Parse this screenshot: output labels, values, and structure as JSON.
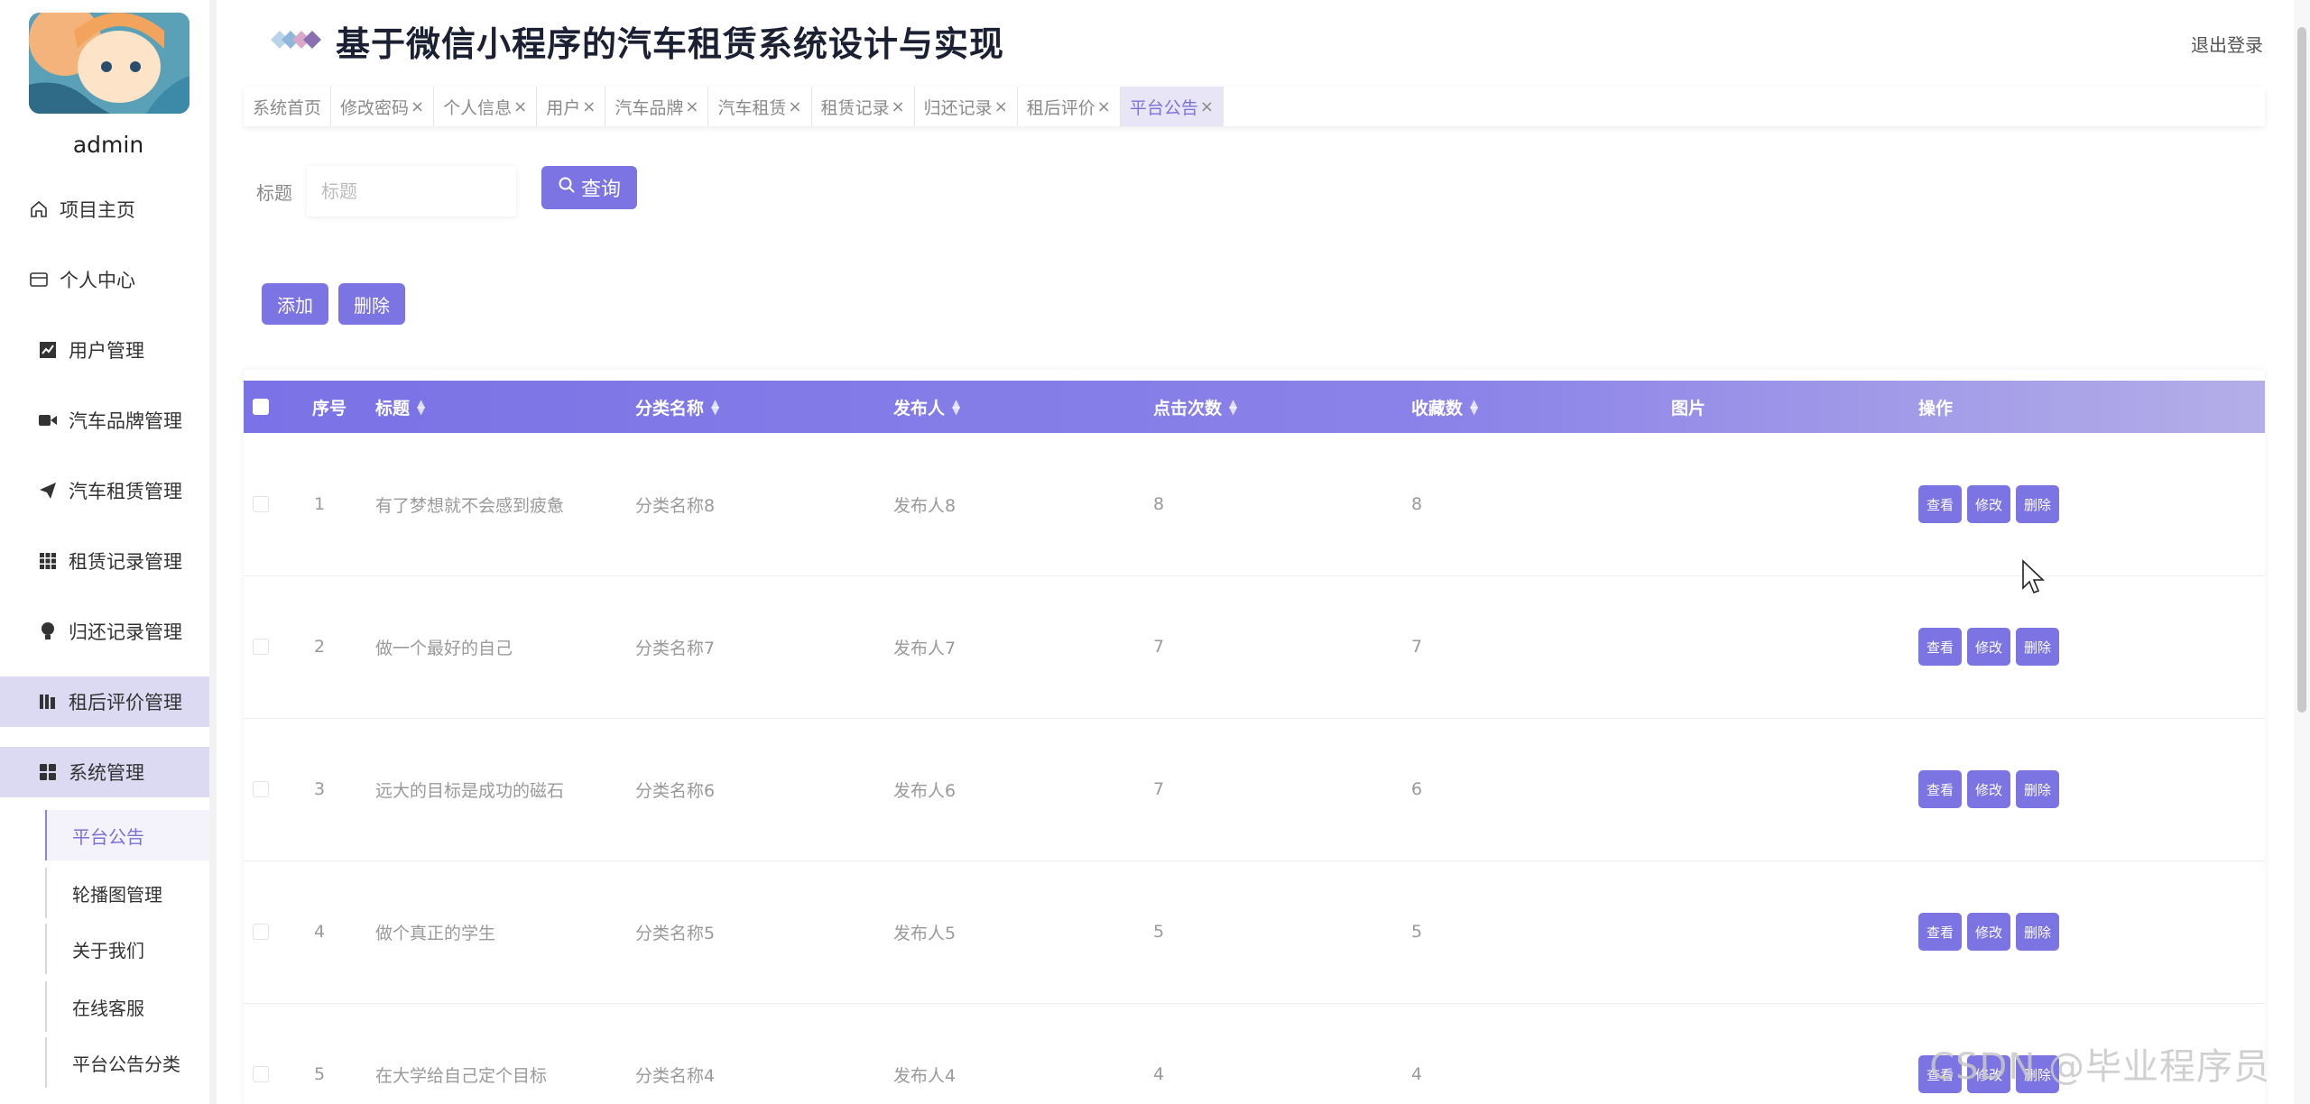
{
  "app": {
    "title": "基于微信小程序的汽车租赁系统设计与实现",
    "logout": "退出登录",
    "username": "admin"
  },
  "sidebar": {
    "items": [
      {
        "label": "项目主页",
        "icon": "home-icon"
      },
      {
        "label": "个人中心",
        "icon": "id-card-icon"
      },
      {
        "label": "用户管理",
        "icon": "chart-line-icon"
      },
      {
        "label": "汽车品牌管理",
        "icon": "video-icon"
      },
      {
        "label": "汽车租赁管理",
        "icon": "paper-plane-icon"
      },
      {
        "label": "租赁记录管理",
        "icon": "grid-icon"
      },
      {
        "label": "归还记录管理",
        "icon": "bulb-icon"
      },
      {
        "label": "租后评价管理",
        "icon": "book-icon"
      },
      {
        "label": "系统管理",
        "icon": "apps-icon"
      }
    ],
    "sub_items": [
      "平台公告",
      "轮播图管理",
      "关于我们",
      "在线客服",
      "平台公告分类"
    ]
  },
  "tabs": [
    {
      "label": "系统首页",
      "closable": false
    },
    {
      "label": "修改密码",
      "closable": true
    },
    {
      "label": "个人信息",
      "closable": true
    },
    {
      "label": "用户",
      "closable": true
    },
    {
      "label": "汽车品牌",
      "closable": true
    },
    {
      "label": "汽车租赁",
      "closable": true
    },
    {
      "label": "租赁记录",
      "closable": true
    },
    {
      "label": "归还记录",
      "closable": true
    },
    {
      "label": "租后评价",
      "closable": true
    },
    {
      "label": "平台公告",
      "closable": true,
      "active": true
    }
  ],
  "tab_close_glyph": "×",
  "search": {
    "label": "标题",
    "placeholder": "标题",
    "button": "查询"
  },
  "actions": {
    "add": "添加",
    "delete": "删除"
  },
  "table": {
    "columns": [
      "序号",
      "标题",
      "分类名称",
      "发布人",
      "点击次数",
      "收藏数",
      "图片",
      "操作"
    ],
    "row_buttons": {
      "view": "查看",
      "edit": "修改",
      "delete": "删除"
    },
    "rows": [
      {
        "index": "1",
        "title": "有了梦想就不会感到疲惫",
        "category": "分类名称8",
        "publisher": "发布人8",
        "clicks": "8",
        "favorites": "8"
      },
      {
        "index": "2",
        "title": "做一个最好的自己",
        "category": "分类名称7",
        "publisher": "发布人7",
        "clicks": "7",
        "favorites": "7"
      },
      {
        "index": "3",
        "title": "远大的目标是成功的磁石",
        "category": "分类名称6",
        "publisher": "发布人6",
        "clicks": "7",
        "favorites": "6"
      },
      {
        "index": "4",
        "title": "做个真正的学生",
        "category": "分类名称5",
        "publisher": "发布人5",
        "clicks": "5",
        "favorites": "5"
      },
      {
        "index": "5",
        "title": "在大学给自己定个目标",
        "category": "分类名称4",
        "publisher": "发布人4",
        "clicks": "4",
        "favorites": "4"
      }
    ]
  },
  "watermark": "CSDN @毕业程序员",
  "colors": {
    "accent": "#7c74e2",
    "active_menu_bg": "#dcdaf2"
  }
}
